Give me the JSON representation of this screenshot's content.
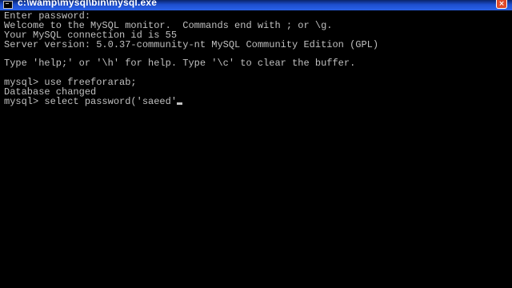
{
  "window": {
    "title": "c:\\wamp\\mysql\\bin\\mysql.exe",
    "close_label": "×"
  },
  "console": {
    "lines": [
      "Enter password:",
      "Welcome to the MySQL monitor.  Commands end with ; or \\g.",
      "Your MySQL connection id is 55",
      "Server version: 5.0.37-community-nt MySQL Community Edition (GPL)",
      "",
      "Type 'help;' or '\\h' for help. Type '\\c' to clear the buffer.",
      "",
      "mysql> use freeforarab;",
      "Database changed",
      "mysql> select password('saeed'"
    ]
  },
  "colors": {
    "console_background": "#000000",
    "console_text": "#c0c0c0",
    "titlebar": "#2a62e8"
  }
}
